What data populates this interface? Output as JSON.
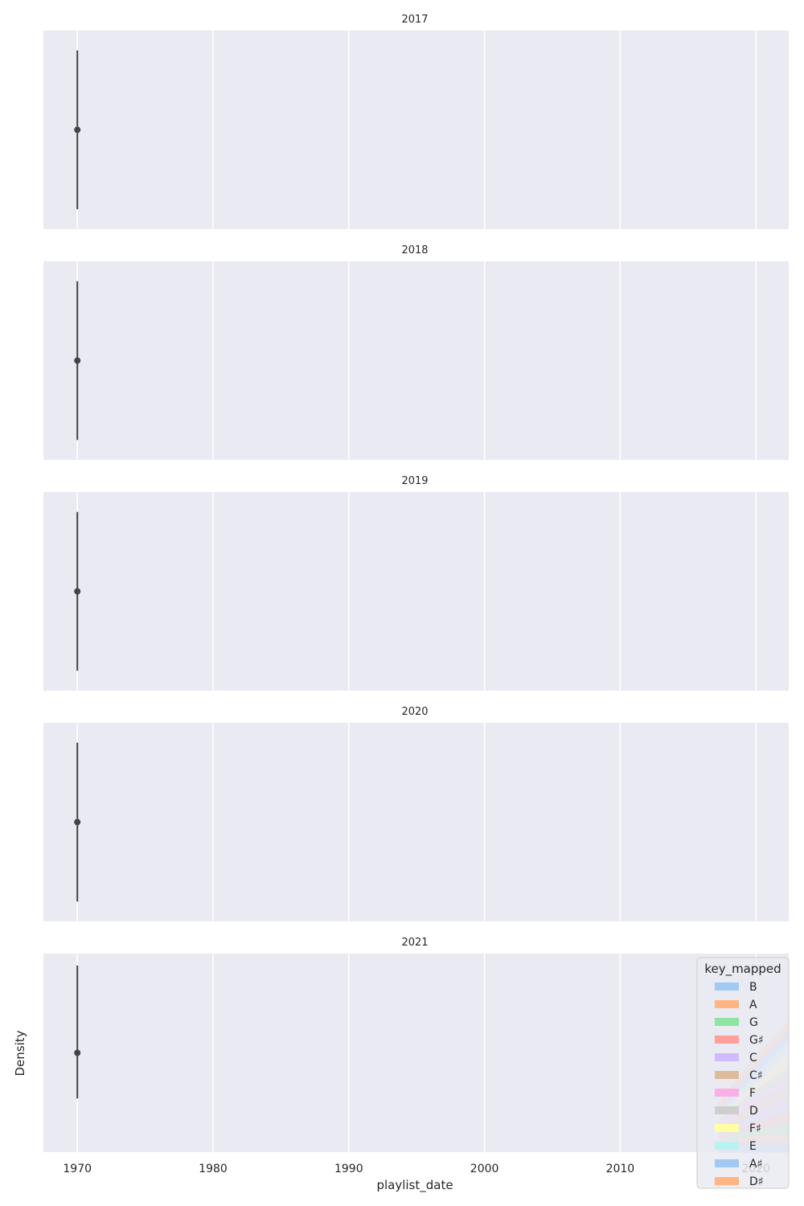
{
  "chart_data": {
    "type": "area",
    "layout": "faceted rows",
    "xlabel": "playlist_date",
    "ylabel": "Density",
    "x_ticks": [
      "1970",
      "1980",
      "1990",
      "2000",
      "2010",
      "2020"
    ],
    "xlim": [
      "1967-07",
      "2022-06"
    ],
    "grid": true,
    "facets": [
      {
        "title": "2017",
        "point": {
          "x": "1970",
          "y": 0.5
        },
        "whisker": [
          0.1,
          0.9
        ]
      },
      {
        "title": "2018",
        "point": {
          "x": "1970",
          "y": 0.5
        },
        "whisker": [
          0.1,
          0.9
        ]
      },
      {
        "title": "2019",
        "point": {
          "x": "1970",
          "y": 0.5
        },
        "whisker": [
          0.1,
          0.9
        ]
      },
      {
        "title": "2020",
        "point": {
          "x": "1970",
          "y": 0.5
        },
        "whisker": [
          0.1,
          0.9
        ]
      },
      {
        "title": "2021",
        "point": {
          "x": "1970",
          "y": 0.5
        },
        "whisker": [
          0.27,
          0.94
        ]
      }
    ],
    "legend": {
      "title": "key_mapped",
      "placement": "right, bottom facet",
      "entries": [
        {
          "label": "B",
          "color": "#a1c9f4"
        },
        {
          "label": "A",
          "color": "#ffb482"
        },
        {
          "label": "G",
          "color": "#8de5a1"
        },
        {
          "label": "G♯",
          "color": "#ff9f9b"
        },
        {
          "label": "C",
          "color": "#d0bbff"
        },
        {
          "label": "C♯",
          "color": "#debb9b"
        },
        {
          "label": "F",
          "color": "#fab0e4"
        },
        {
          "label": "D",
          "color": "#cfcfcf"
        },
        {
          "label": "F♯",
          "color": "#fffea3"
        },
        {
          "label": "E",
          "color": "#b9f2f0"
        },
        {
          "label": "A♯",
          "color": "#a1c9f4"
        },
        {
          "label": "D♯",
          "color": "#ffb482"
        }
      ]
    }
  }
}
